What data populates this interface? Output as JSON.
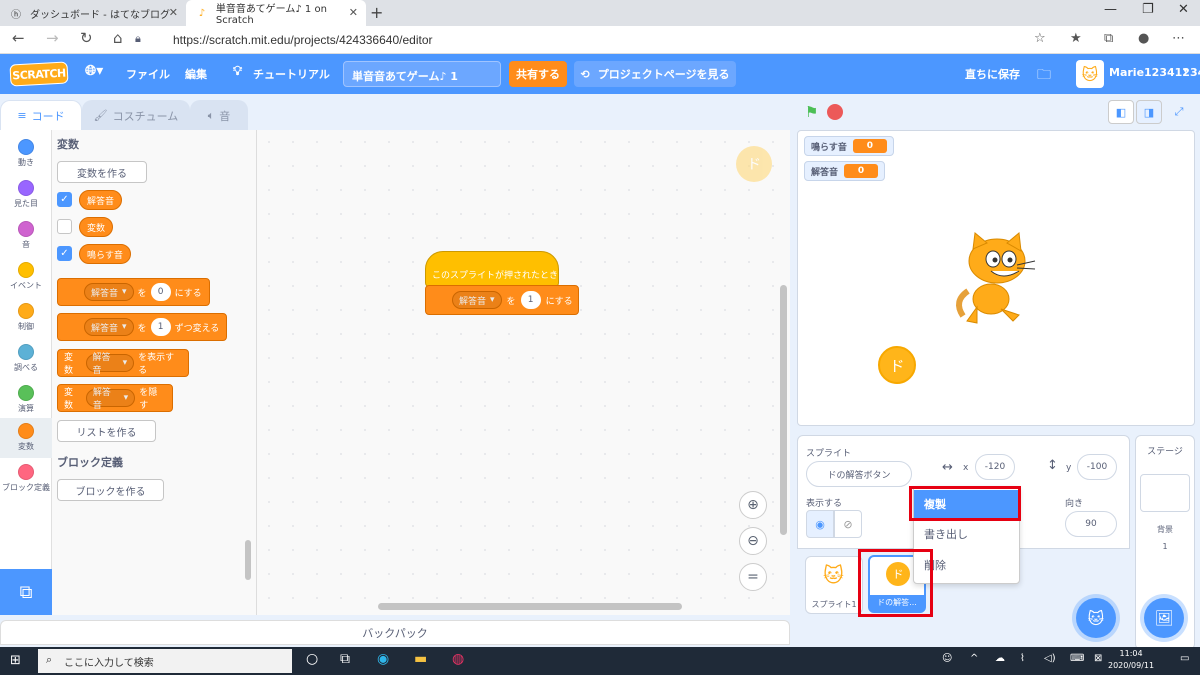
{
  "browser": {
    "tabs": [
      {
        "title": "ダッシュボード - はてなブログ",
        "icon": "hatena-icon"
      },
      {
        "title": "単音音あてゲーム♪ 1 on Scratch",
        "icon": "scratch-icon"
      }
    ],
    "url": "https://scratch.mit.edu/projects/424336640/editor"
  },
  "menubar": {
    "logo": "SCRATCH",
    "file": "ファイル",
    "edit": "編集",
    "tutorial": "チュートリアル",
    "project_title": "単音音あてゲーム♪ 1",
    "share": "共有する",
    "project_page": "プロジェクトページを見る",
    "save_now": "直ちに保存",
    "username": "Marie12341234"
  },
  "editor_tabs": {
    "code": "コード",
    "costume": "コスチューム",
    "sound": "音"
  },
  "categories": [
    {
      "label": "動き",
      "color": "#4c97ff"
    },
    {
      "label": "見た目",
      "color": "#9966ff"
    },
    {
      "label": "音",
      "color": "#cf63cf"
    },
    {
      "label": "イベント",
      "color": "#ffbf00"
    },
    {
      "label": "制御",
      "color": "#ffab19"
    },
    {
      "label": "調べる",
      "color": "#5cb1d6"
    },
    {
      "label": "演算",
      "color": "#59c059"
    },
    {
      "label": "変数",
      "color": "#ff8c1a"
    },
    {
      "label": "ブロック定義",
      "color": "#ff6680"
    }
  ],
  "palette": {
    "variables_heading": "変数",
    "make_variable": "変数を作る",
    "variables": [
      {
        "name": "解答音",
        "checked": true
      },
      {
        "name": "変数",
        "checked": false
      },
      {
        "name": "鳴らす音",
        "checked": true
      }
    ],
    "set_block": {
      "var": "解答音",
      "to": "を",
      "value": "0",
      "suffix": "にする"
    },
    "change_block": {
      "var": "解答音",
      "to": "を",
      "value": "1",
      "suffix": "ずつ変える"
    },
    "show_block": {
      "prefix": "変数",
      "var": "解答音",
      "suffix": "を表示する"
    },
    "hide_block": {
      "prefix": "変数",
      "var": "解答音",
      "suffix": "を隠す"
    },
    "make_list": "リストを作る",
    "myblocks_heading": "ブロック定義",
    "make_block": "ブロックを作る"
  },
  "script": {
    "hat": "このスプライトが押されたとき",
    "set_var": "解答音",
    "set_to": "を",
    "set_value": "1",
    "set_suffix": "にする"
  },
  "sprite_thumb_char": "ド",
  "backpack": "バックパック",
  "stage": {
    "monitors": [
      {
        "label": "鳴らす音",
        "value": "0"
      },
      {
        "label": "解答音",
        "value": "0"
      }
    ],
    "button_char": "ド"
  },
  "sprite_info": {
    "sprite_label": "スプライト",
    "sprite_name": "ドの解答ボタン",
    "x_label": "x",
    "x_value": "-120",
    "y_label": "y",
    "y_value": "-100",
    "show_label": "表示する",
    "direction_label": "向き",
    "direction_value": "90"
  },
  "sprites": [
    {
      "name": "スプライト1"
    },
    {
      "name": "ドの解答..."
    }
  ],
  "stage_pane": {
    "title": "ステージ",
    "backdrop_label": "背景",
    "backdrop_count": "1"
  },
  "context_menu": {
    "duplicate": "複製",
    "export": "書き出し",
    "delete": "削除"
  },
  "taskbar": {
    "search": "ここに入力して検索",
    "time": "11:04",
    "date": "2020/09/11"
  },
  "colors": {
    "scratch_blue": "#4c97ff",
    "variable_orange": "#ff8c1a",
    "events_yellow": "#ffbf00",
    "highlight_red": "#e60012"
  }
}
